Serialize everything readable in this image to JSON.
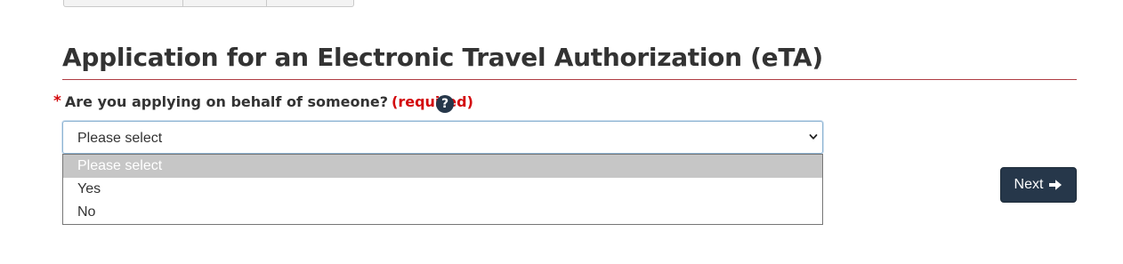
{
  "heading": {
    "title": "Application for an Electronic Travel Authorization (eTA)"
  },
  "question": {
    "asterisk": "*",
    "label": "Are you applying on behalf of someone?",
    "required": "(required)",
    "help_icon": "question-circle-icon",
    "help_glyph": "?"
  },
  "select": {
    "value": "Please select",
    "options": [
      "Please select",
      "Yes",
      "No"
    ],
    "highlighted_index": 0
  },
  "actions": {
    "next_label": "Next",
    "next_icon": "arrow-right-icon"
  },
  "colors": {
    "heading_rule": "#af3c43",
    "required": "#d3080c",
    "button": "#26374a",
    "option_highlight": "#c6c6c6"
  }
}
